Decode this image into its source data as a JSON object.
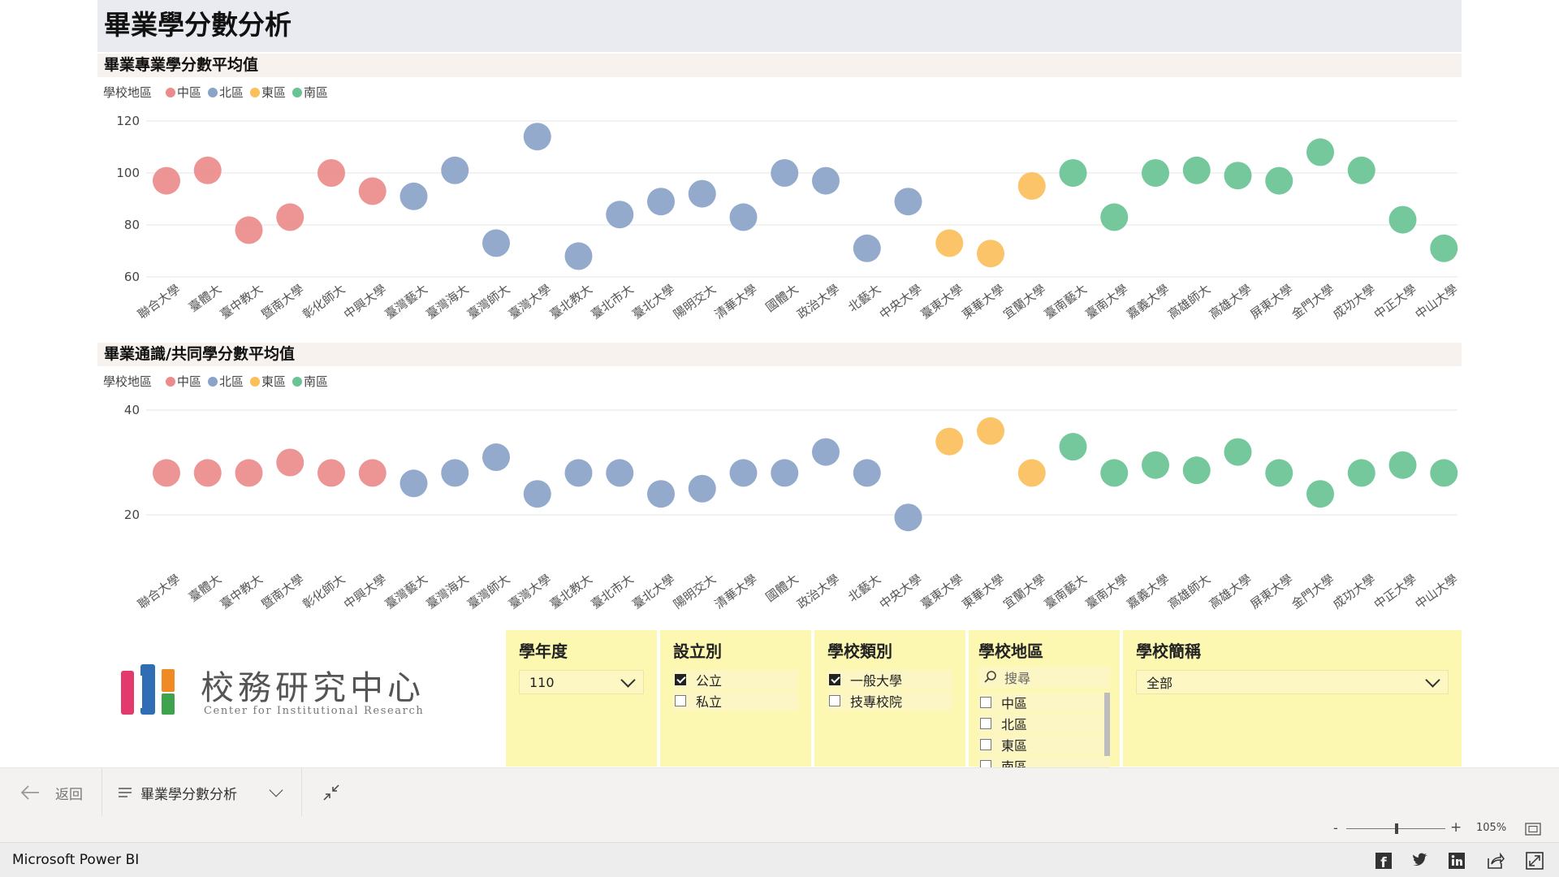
{
  "report": {
    "title": "畢業學分數分析"
  },
  "charts": {
    "major": {
      "title": "畢業專業學分數平均值",
      "legend_title": "學校地區"
    },
    "general": {
      "title": "畢業通識/共同學分數平均值",
      "legend_title": "學校地區"
    }
  },
  "regions": [
    {
      "name": "中區",
      "color": "#ec8b8b"
    },
    {
      "name": "北區",
      "color": "#8aa3c8"
    },
    {
      "name": "東區",
      "color": "#fbbf5b"
    },
    {
      "name": "南區",
      "color": "#69c394"
    }
  ],
  "chart_data": [
    {
      "type": "scatter",
      "title": "畢業專業學分數平均值",
      "legend_title": "學校地區",
      "ylim": [
        60,
        120
      ],
      "yticks": [
        60,
        80,
        100,
        120
      ],
      "categories": [
        "聯合大學",
        "臺體大",
        "臺中教大",
        "暨南大學",
        "彰化師大",
        "中興大學",
        "臺灣藝大",
        "臺灣海大",
        "臺灣師大",
        "臺灣大學",
        "臺北教大",
        "臺北市大",
        "臺北大學",
        "陽明交大",
        "清華大學",
        "國體大",
        "政治大學",
        "北藝大",
        "中央大學",
        "臺東大學",
        "東華大學",
        "宜蘭大學",
        "臺南藝大",
        "臺南大學",
        "嘉義大學",
        "高雄師大",
        "高雄大學",
        "屏東大學",
        "金門大學",
        "成功大學",
        "中正大學",
        "中山大學"
      ],
      "region": [
        "中區",
        "中區",
        "中區",
        "中區",
        "中區",
        "中區",
        "北區",
        "北區",
        "北區",
        "北區",
        "北區",
        "北區",
        "北區",
        "北區",
        "北區",
        "北區",
        "北區",
        "北區",
        "北區",
        "東區",
        "東區",
        "東區",
        "南區",
        "南區",
        "南區",
        "南區",
        "南區",
        "南區",
        "南區",
        "南區",
        "南區",
        "南區"
      ],
      "values": [
        97,
        101,
        78,
        83,
        100,
        93,
        91,
        101,
        73,
        114,
        68,
        84,
        89,
        92,
        83,
        100,
        97,
        71,
        89,
        73,
        69,
        95,
        100,
        83,
        100,
        101,
        99,
        97,
        108,
        101,
        82,
        71
      ]
    },
    {
      "type": "scatter",
      "title": "畢業通識/共同學分數平均值",
      "legend_title": "學校地區",
      "ylim": [
        20,
        40
      ],
      "yticks": [
        20,
        40
      ],
      "categories": [
        "聯合大學",
        "臺體大",
        "臺中教大",
        "暨南大學",
        "彰化師大",
        "中興大學",
        "臺灣藝大",
        "臺灣海大",
        "臺灣師大",
        "臺灣大學",
        "臺北教大",
        "臺北市大",
        "臺北大學",
        "陽明交大",
        "清華大學",
        "國體大",
        "政治大學",
        "北藝大",
        "中央大學",
        "臺東大學",
        "東華大學",
        "宜蘭大學",
        "臺南藝大",
        "臺南大學",
        "嘉義大學",
        "高雄師大",
        "高雄大學",
        "屏東大學",
        "金門大學",
        "成功大學",
        "中正大學",
        "中山大學"
      ],
      "region": [
        "中區",
        "中區",
        "中區",
        "中區",
        "中區",
        "中區",
        "北區",
        "北區",
        "北區",
        "北區",
        "北區",
        "北區",
        "北區",
        "北區",
        "北區",
        "北區",
        "北區",
        "北區",
        "北區",
        "東區",
        "東區",
        "東區",
        "南區",
        "南區",
        "南區",
        "南區",
        "南區",
        "南區",
        "南區",
        "南區",
        "南區",
        "南區"
      ],
      "values": [
        28,
        28,
        28,
        30,
        28,
        28,
        26,
        28,
        31,
        24,
        28,
        28,
        24,
        25,
        28,
        28,
        32,
        28,
        19.5,
        34,
        36,
        28,
        33,
        28,
        29.5,
        28.5,
        32,
        28,
        24,
        28,
        29.5,
        28
      ]
    }
  ],
  "logo": {
    "main_text": "校務研究中心",
    "sub_text": "Center for Institutional Research"
  },
  "slicers": {
    "year": {
      "title": "學年度",
      "selected": "110"
    },
    "establishment": {
      "title": "設立別",
      "options": [
        {
          "label": "公立",
          "checked": true
        },
        {
          "label": "私立",
          "checked": false
        }
      ]
    },
    "school_type": {
      "title": "學校類別",
      "options": [
        {
          "label": "一般大學",
          "checked": true
        },
        {
          "label": "技專校院",
          "checked": false
        }
      ]
    },
    "region": {
      "title": "學校地區",
      "search_placeholder": "搜尋",
      "options": [
        {
          "label": "中區",
          "checked": false
        },
        {
          "label": "北區",
          "checked": false
        },
        {
          "label": "東區",
          "checked": false
        },
        {
          "label": "南區",
          "checked": false
        }
      ]
    },
    "school_name": {
      "title": "學校簡稱",
      "selected": "全部"
    }
  },
  "nav": {
    "back_label": "返回",
    "page_label": "畢業學分數分析"
  },
  "zoom": {
    "level": "105%"
  },
  "footer": {
    "brand": "Microsoft Power BI"
  }
}
